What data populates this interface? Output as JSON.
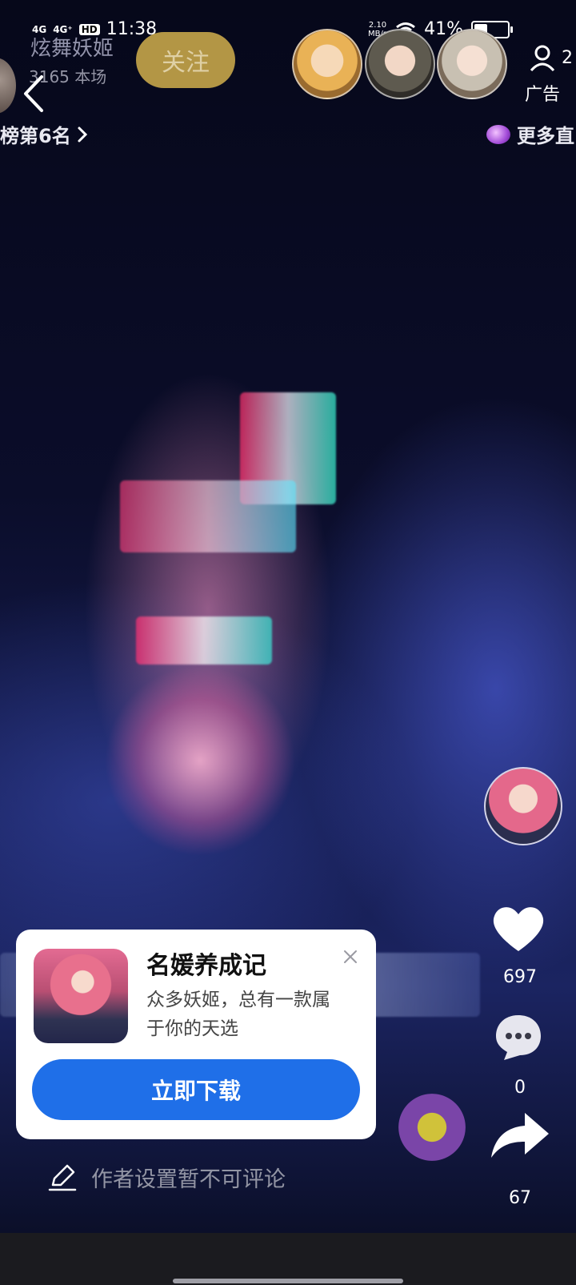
{
  "status_bar": {
    "signal1": "4G",
    "signal2": "4G⁺",
    "hd": "HD",
    "time": "11:38",
    "net_speed": "2.10",
    "net_unit": "MB/s",
    "battery": "41%"
  },
  "header": {
    "streamer_name": "炫舞妖姬",
    "viewer_count": "3165 本场",
    "follow_label": "关注",
    "online_count": "2",
    "ad_label": "广告",
    "rank_label": "榜第6名",
    "more_label": "更多直"
  },
  "side_actions": {
    "like_count": "697",
    "comment_count": "0",
    "share_count": "67"
  },
  "ad_card": {
    "title": "名媛养成记",
    "description": "众多妖姬，总有一款属于你的天选",
    "download_label": "立即下载"
  },
  "comment_bar": {
    "placeholder": "作者设置暂不可评论"
  },
  "colors": {
    "accent_blue": "#1f6fe8",
    "follow_gold": "#c6a64a"
  }
}
